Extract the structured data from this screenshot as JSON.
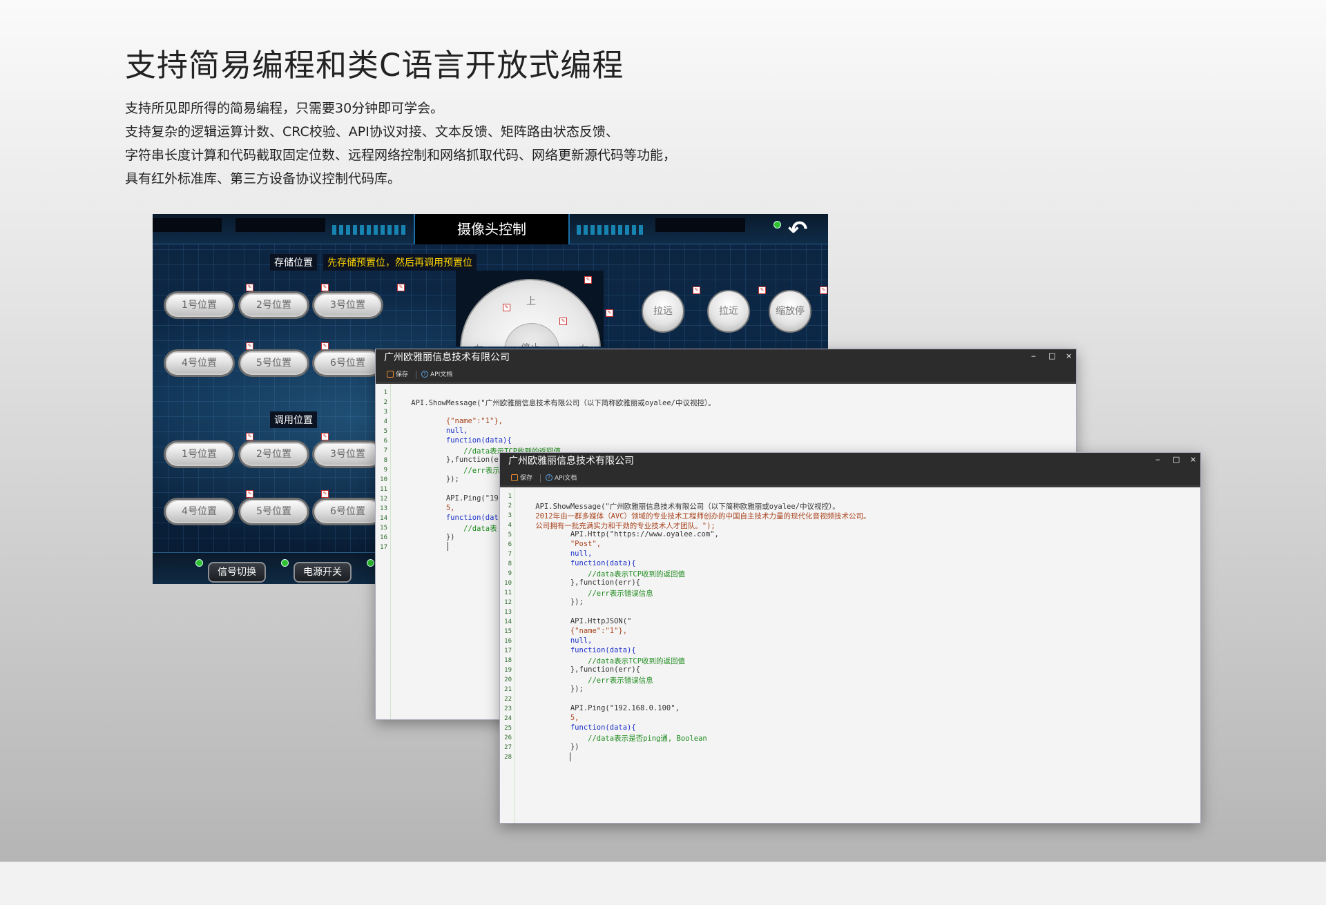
{
  "page": {
    "title": "支持简易编程和类C语言开放式编程",
    "description": [
      "支持所见即所得的简易编程，只需要30分钟即可学会。",
      "支持复杂的逻辑运算计数、CRC校验、API协议对接、文本反馈、矩阵路由状态反馈、",
      "字符串长度计算和代码截取固定位数、远程网络控制和网络抓取代码、网络更新源代码等功能，",
      "具有红外标准库、第三方设备协议控制代码库。"
    ]
  },
  "camera_panel": {
    "title": "摄像头控制",
    "store_label": "存储位置",
    "hint": "先存储预置位，然后再调用预置位",
    "call_label": "调用位置",
    "store_buttons": [
      "1号位置",
      "2号位置",
      "3号位置",
      "4号位置",
      "5号位置",
      "6号位置"
    ],
    "call_buttons": [
      "1号位置",
      "2号位置",
      "3号位置",
      "4号位置",
      "5号位置",
      "6号位置"
    ],
    "joystick": {
      "up": "上",
      "left": "左",
      "right": "右",
      "stop": "停止"
    },
    "zoom_buttons": [
      "拉远",
      "拉近",
      "缩放停"
    ],
    "bottom_buttons": [
      "信号切换",
      "电源开关"
    ],
    "back_icon": "back-arrow-icon",
    "status_color": "#2fc12f"
  },
  "editor_back": {
    "title": "广州欧雅丽信息技术有限公司",
    "toolbar": {
      "save": "保存",
      "api_doc": "API文档"
    },
    "window_controls": [
      "‒",
      "□",
      "×"
    ],
    "line_count": 17,
    "lines": [
      "",
      "    API.ShowMessage(\"广州欧雅丽信息技术有限公司（以下简称欧雅丽或oyalee/中议视控）。",
      "",
      "            {\"name\":\"1\"},",
      "            null,",
      "            function(data){",
      "                //data表示TCP收到的返回值",
      "            },function(err){",
      "                //err表示",
      "            });",
      "",
      "            API.Ping(\"19",
      "            5,",
      "            function(dat",
      "                //data表",
      "            })",
      ""
    ]
  },
  "editor_front": {
    "title": "广州欧雅丽信息技术有限公司",
    "toolbar": {
      "save": "保存",
      "api_doc": "API文档"
    },
    "window_controls": [
      "‒",
      "□",
      "×"
    ],
    "line_count": 28,
    "lines": [
      "",
      "    API.ShowMessage(\"广州欧雅丽信息技术有限公司（以下简称欧雅丽或oyalee/中议视控）。",
      "    2012年由一群多媒体（AVC）领域的专业技术工程师创办的中国自主技术力量的现代化音视频技术公司。",
      "    公司拥有一批充满实力和干劲的专业技术人才团队。\");",
      "            API.Http(\"https://www.oyalee.com\",",
      "            \"Post\",",
      "            null,",
      "            function(data){",
      "                //data表示TCP收到的返回值",
      "            },function(err){",
      "                //err表示错误信息",
      "            });",
      "",
      "            API.HttpJSON(\"",
      "            {\"name\":\"1\"},",
      "            null,",
      "            function(data){",
      "                //data表示TCP收到的返回值",
      "            },function(err){",
      "                //err表示错误信息",
      "            });",
      "",
      "            API.Ping(\"192.168.0.100\",",
      "            5,",
      "            function(data){",
      "                //data表示是否ping通, Boolean",
      "            })",
      ""
    ]
  }
}
